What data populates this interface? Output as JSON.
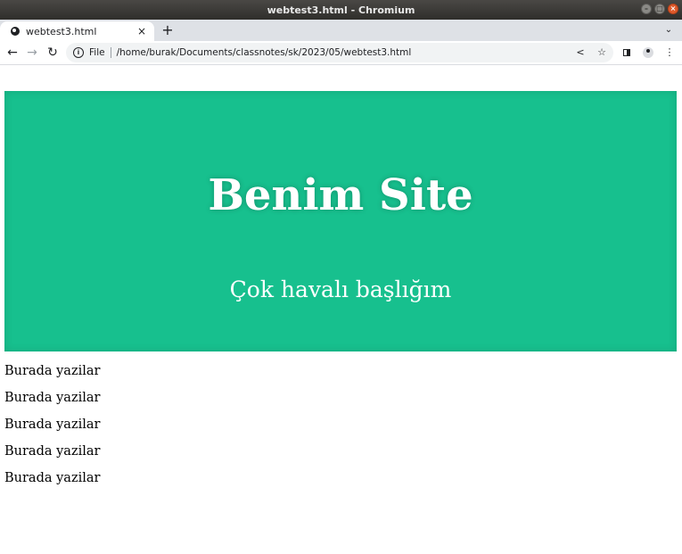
{
  "window": {
    "title": "webtest3.html - Chromium",
    "buttons": {
      "minimize": "–",
      "maximize": "□",
      "close": "×"
    }
  },
  "tabs": [
    {
      "title": "webtest3.html",
      "favicon": "globe-icon",
      "close": "×"
    }
  ],
  "tabstrip": {
    "new_tab": "+",
    "tab_search": "⌄"
  },
  "toolbar": {
    "back": "←",
    "forward": "→",
    "reload": "↻",
    "omnibox": {
      "info": "i",
      "scheme_label": "File",
      "url": "/home/burak/Documents/classnotes/sk/2023/05/webtest3.html",
      "share": "<",
      "bookmark": "☆"
    },
    "menu": "⋮"
  },
  "page": {
    "hero": {
      "title": "Benim Site",
      "subtitle": "Çok havalı başlığım",
      "background_color": "#17c08e",
      "text_color": "#ffffff"
    },
    "paragraphs": [
      "Burada yazilar",
      "Burada yazilar",
      "Burada yazilar",
      "Burada yazilar",
      "Burada yazilar"
    ]
  }
}
